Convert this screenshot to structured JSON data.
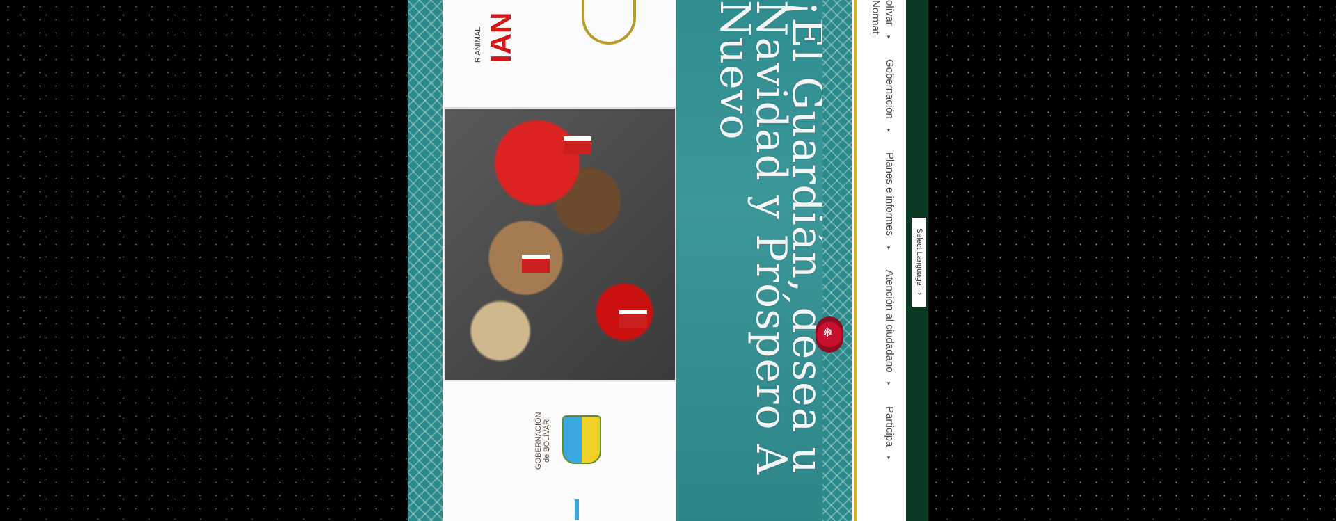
{
  "page": {
    "background": "#000000",
    "teal_color": "#2f8d90",
    "nav_bg": "#ffffff",
    "gold_accent": "#d2b51c",
    "rail_color": "#0a3a24"
  },
  "banner": {
    "text": "¡El Guardián, desea u\nNavidad y Próspero A\nNuevo"
  },
  "logo": {
    "wordmark": "IAN",
    "tagline": "R ANIMAL"
  },
  "government_logo": {
    "text": "GOBERNACIÓN\nde BOLÍVAR"
  },
  "navigation": {
    "items": [
      {
        "label": "olívar",
        "caret": "▾"
      },
      {
        "label": "Gobernación",
        "caret": "▾"
      },
      {
        "label": "Planes e informes",
        "caret": "▾"
      },
      {
        "label": "Atención al ciudadano",
        "caret": "▾"
      },
      {
        "label": "Participa",
        "caret": "▾"
      },
      {
        "label": "Normat",
        "caret": ""
      }
    ]
  },
  "language": {
    "label": "Select Language",
    "icon": "chevron-down-icon"
  },
  "decorations": {
    "photo": "pets-with-santa-hats",
    "badge_icon": "snowflake-icon"
  }
}
